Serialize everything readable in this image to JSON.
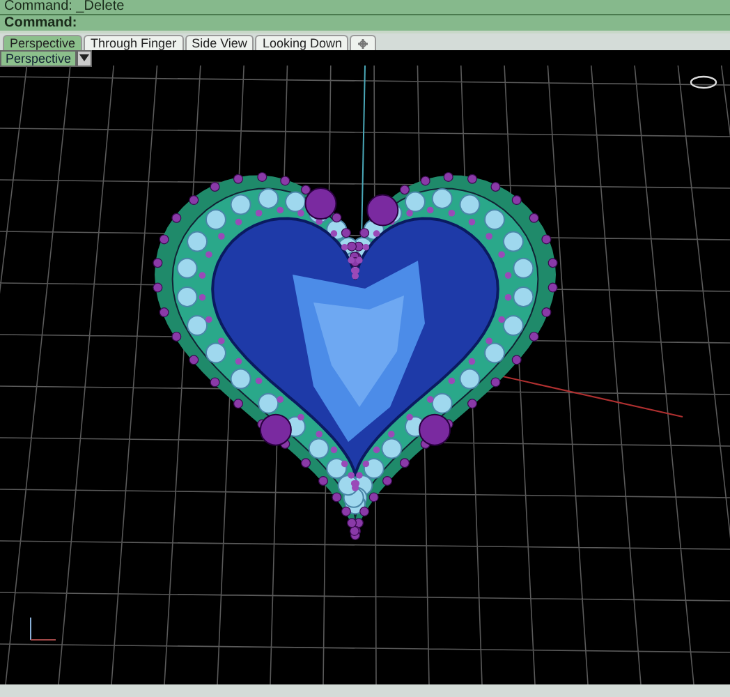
{
  "command_lines": [
    {
      "kind": "history",
      "text": "Command: _Delete"
    },
    {
      "kind": "prompt",
      "text": "Command:"
    }
  ],
  "tabs": [
    {
      "label": "Perspective",
      "selected": true
    },
    {
      "label": "Through Finger",
      "selected": false
    },
    {
      "label": "Side View",
      "selected": false
    },
    {
      "label": "Looking Down",
      "selected": false
    }
  ],
  "viewport": {
    "label": "Perspective"
  }
}
